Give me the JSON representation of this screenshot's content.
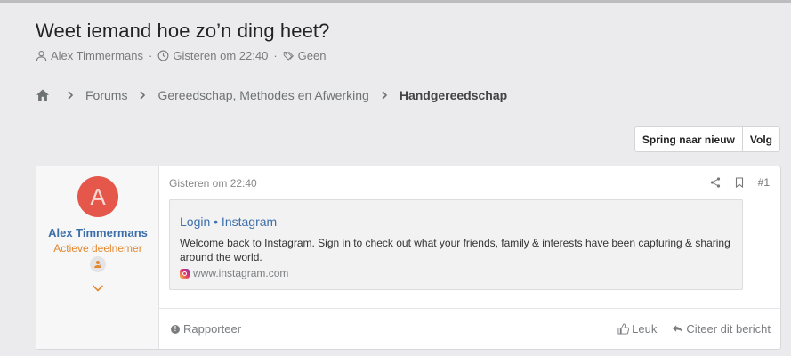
{
  "thread": {
    "title": "Weet iemand hoe zo’n ding heet?",
    "author": "Alex Timmermans",
    "date": "Gisteren om 22:40",
    "tags": "Geen",
    "sep": "·"
  },
  "breadcrumb": {
    "items": [
      "Forums",
      "Gereedschap, Methodes en Afwerking"
    ],
    "current": "Handgereedschap"
  },
  "buttons": {
    "jump_new": "Spring naar nieuw",
    "follow": "Volg"
  },
  "post": {
    "avatar_letter": "A",
    "username": "Alex Timmermans",
    "user_title": "Actieve deelnemer",
    "date": "Gisteren om 22:40",
    "number": "#1",
    "embed": {
      "title": "Login • Instagram",
      "description": "Welcome back to Instagram. Sign in to check out what your friends, family & interests have been capturing & sharing around the world.",
      "domain": "www.instagram.com"
    },
    "report": "Rapporteer",
    "like": "Leuk",
    "quote": "Citeer dit bericht"
  },
  "colors": {
    "background": "#ebebed",
    "link": "#3d6fa9",
    "avatar": "#e4574a",
    "user_title": "#e3892f"
  }
}
